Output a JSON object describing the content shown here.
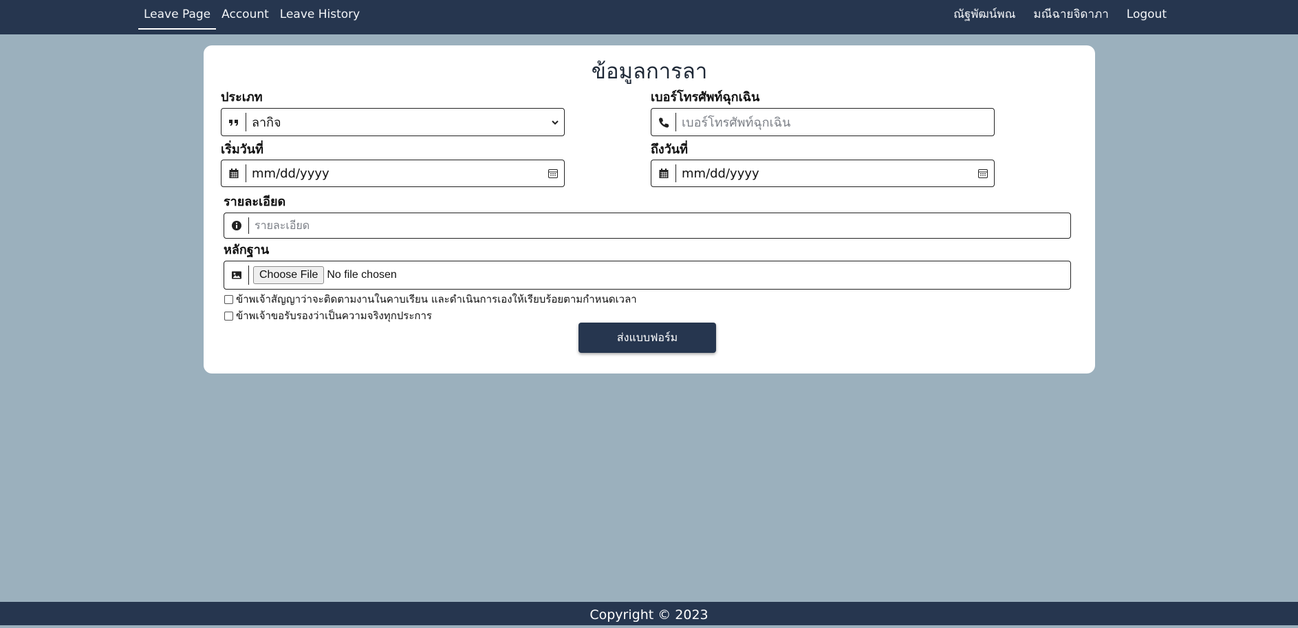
{
  "nav": {
    "leave_page": "Leave Page",
    "account": "Account",
    "leave_history": "Leave History",
    "first_name": "ณัฐพัฒน์พณ",
    "last_name": "มณีฉายจิดาภา",
    "logout": "Logout"
  },
  "form": {
    "title": "ข้อมูลการลา",
    "type_label": "ประเภท",
    "type_value": "ลากิจ",
    "phone_label": "เบอร์โทรศัพท์ฉุกเฉิน",
    "phone_placeholder": "เบอร์โทรศัพท์ฉุกเฉิน",
    "start_label": "เริ่มวันที่",
    "start_value": "mm/dd/yyyy",
    "end_label": "ถึงวันที่",
    "end_value": "mm/dd/yyyy",
    "detail_label": "รายละเอียด",
    "detail_placeholder": "รายละเอียด",
    "evidence_label": "หลักฐาน",
    "choose_file": "Choose File",
    "no_file": "No file chosen",
    "agree1": "ข้าพเจ้าสัญญาว่าจะติดตามงานในคาบเรียน และดำเนินการเองให้เรียบร้อยตามกำหนดเวลา",
    "agree2": "ข้าพเจ้าขอรับรองว่าเป็นความจริงทุกประการ",
    "submit": "ส่งแบบฟอร์ม"
  },
  "footer": {
    "copyright": "Copyright © 2023"
  },
  "colors": {
    "navbar": "#26364f",
    "background": "#9bb0bd",
    "card": "#ffffff"
  }
}
